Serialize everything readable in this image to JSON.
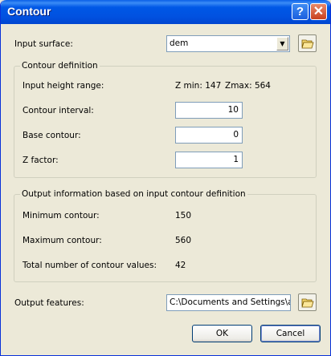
{
  "window": {
    "title": "Contour"
  },
  "titlebar": {
    "help_label": "?",
    "close_label": "✕"
  },
  "input": {
    "surface_label": "Input surface:",
    "surface_value": "dem"
  },
  "contour_definition": {
    "legend": "Contour definition",
    "height_range_label": "Input height range:",
    "zmin": "Z min: 147",
    "zmax": "Zmax: 564",
    "interval_label": "Contour interval:",
    "interval_value": "10",
    "base_label": "Base contour:",
    "base_value": "0",
    "zfactor_label": "Z factor:",
    "zfactor_value": "1"
  },
  "output_info": {
    "legend": "Output information based on input contour definition",
    "min_label": "Minimum contour:",
    "min_value": "150",
    "max_label": "Maximum contour:",
    "max_value": "560",
    "total_label": "Total number of contour values:",
    "total_value": "42"
  },
  "output": {
    "features_label": "Output features:",
    "features_value": "C:\\Documents and Settings\\ad"
  },
  "buttons": {
    "ok": "OK",
    "cancel": "Cancel"
  },
  "icons": [
    "help-icon",
    "close-icon",
    "chevron-down-icon",
    "folder-open-icon"
  ],
  "colors": {
    "titlebar": "#0058e6",
    "dialog_bg": "#ece9d8",
    "field_border": "#7f9db9"
  }
}
